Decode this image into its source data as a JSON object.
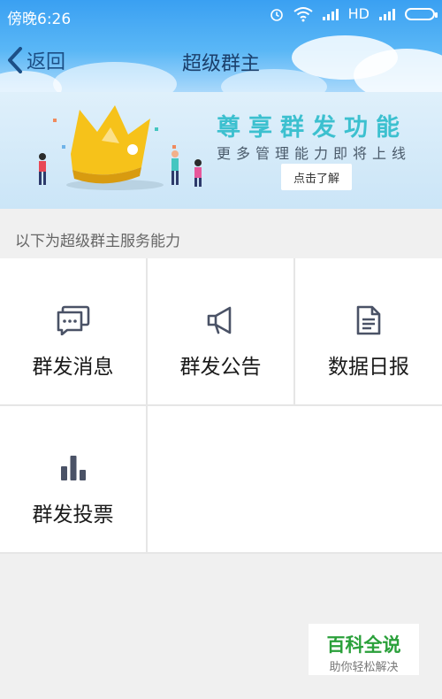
{
  "status": {
    "time": "傍晚6:26",
    "network": "HD"
  },
  "nav": {
    "back_label": "返回",
    "title": "超级群主"
  },
  "banner": {
    "title": "尊享群发功能",
    "subtitle": "更多管理能力即将上线",
    "button_label": "点击了解"
  },
  "section": {
    "header": "以下为超级群主服务能力"
  },
  "features": [
    {
      "label": "群发消息",
      "icon": "chat-bubbles-icon"
    },
    {
      "label": "群发公告",
      "icon": "megaphone-icon"
    },
    {
      "label": "数据日报",
      "icon": "document-icon"
    },
    {
      "label": "群发投票",
      "icon": "bar-chart-icon"
    }
  ],
  "watermark": {
    "title": "百科全说",
    "subtitle": "助你轻松解决"
  },
  "colors": {
    "accent": "#3aa0f2",
    "banner_title": "#3cc0cf",
    "icon": "#4a5266",
    "watermark_green": "#2aa03a"
  }
}
